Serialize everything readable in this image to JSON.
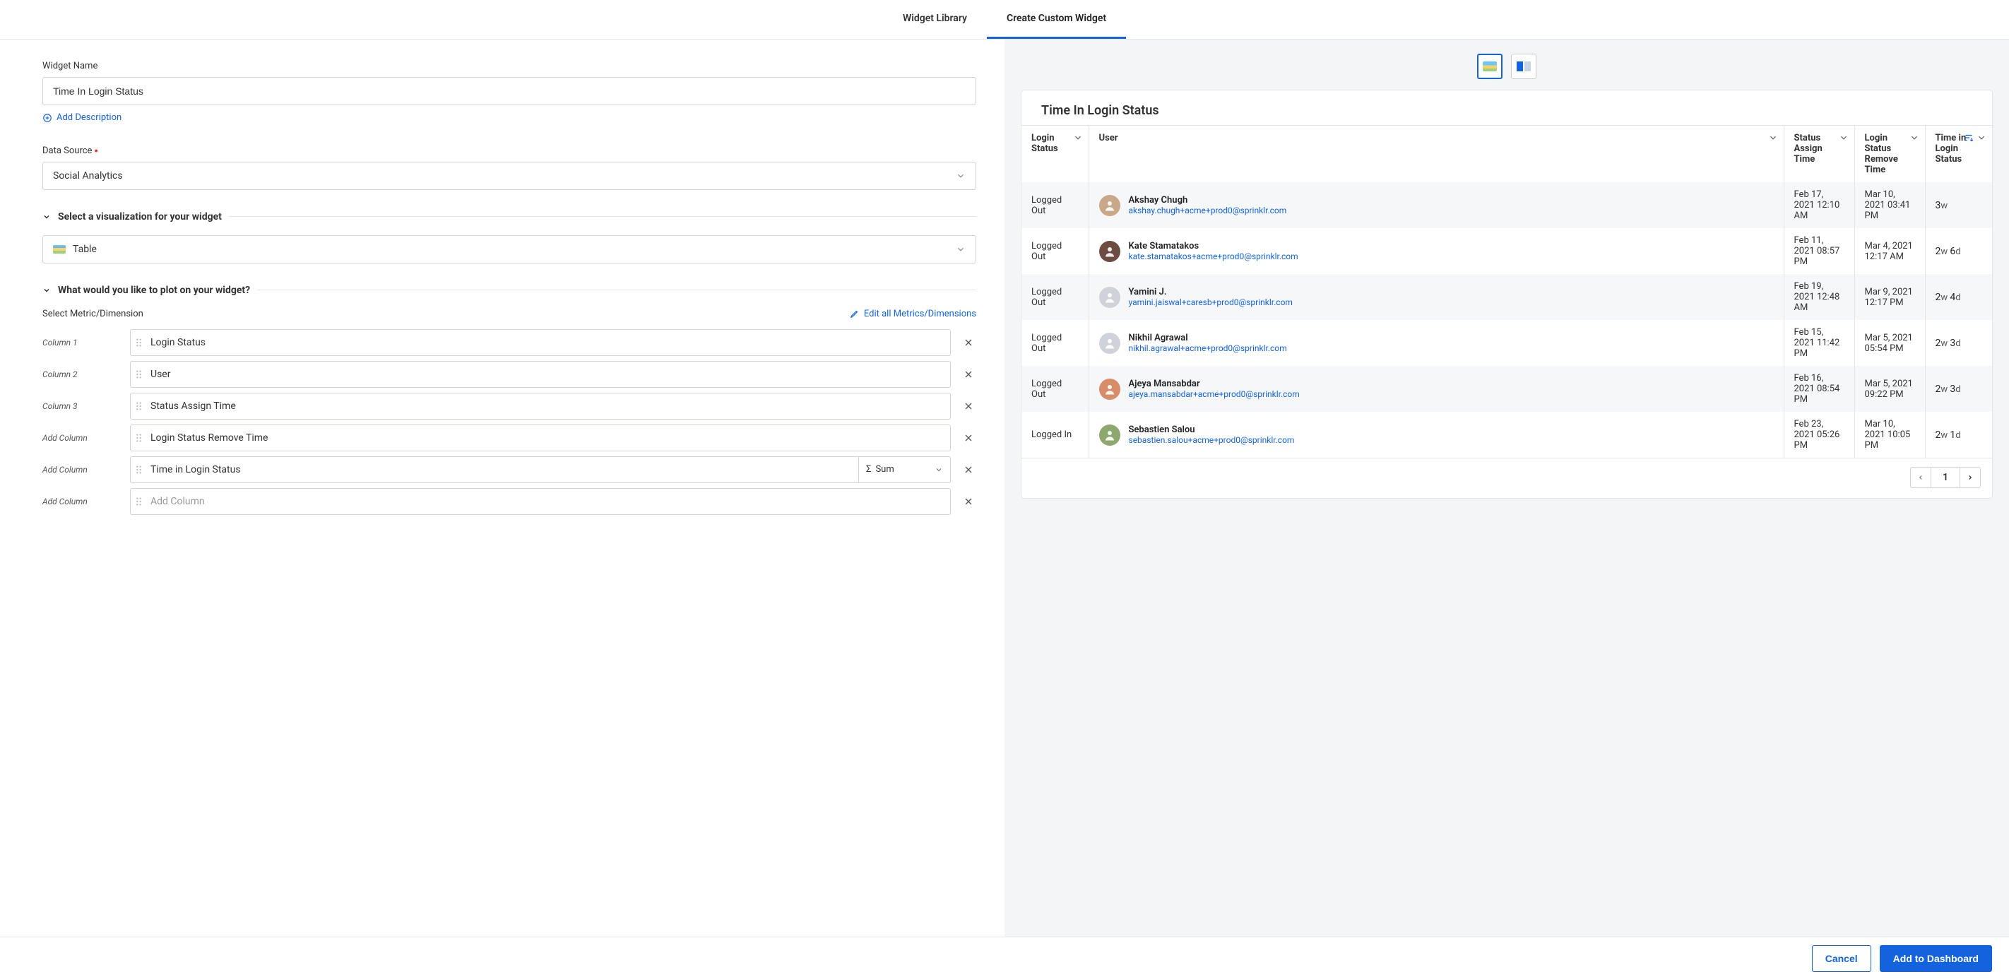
{
  "tabs": {
    "library": "Widget Library",
    "create": "Create Custom Widget"
  },
  "form": {
    "widget_name_label": "Widget Name",
    "widget_name_value": "Time In Login Status",
    "add_description": "Add Description",
    "data_source_label": "Data Source",
    "data_source_value": "Social Analytics",
    "viz_section": "Select a visualization for your widget",
    "viz_value": "Table",
    "plot_section": "What would you like to plot on your widget?",
    "metric_label": "Select Metric/Dimension",
    "edit_all": "Edit all Metrics/Dimensions",
    "columns": [
      {
        "label": "Column 1",
        "value": "Login Status",
        "agg": null
      },
      {
        "label": "Column 2",
        "value": "User",
        "agg": null
      },
      {
        "label": "Column 3",
        "value": "Status Assign Time",
        "agg": null
      },
      {
        "label": "Add Column",
        "value": "Login Status Remove Time",
        "agg": null
      },
      {
        "label": "Add Column",
        "value": "Time in Login Status",
        "agg": "Sum"
      },
      {
        "label": "Add Column",
        "value": "",
        "placeholder": "Add Column",
        "agg": null
      }
    ]
  },
  "preview": {
    "title": "Time In Login Status",
    "headers": {
      "login_status": "Login Status",
      "user": "User",
      "assign": "Status Assign Time",
      "remove": "Login Status Remove Time",
      "tils": "Time in Login Status"
    },
    "rows": [
      {
        "status": "Logged Out",
        "name": "Akshay Chugh",
        "email": "akshay.chugh+acme+prod0@sprinklr.com",
        "assign": "Feb 17, 2021 12:10 AM",
        "remove": "Mar 10, 2021 03:41 PM",
        "tils_a": "3",
        "tils_au": "w",
        "tils_b": "",
        "tils_bu": "",
        "avatar": "#c9a889"
      },
      {
        "status": "Logged Out",
        "name": "Kate Stamatakos",
        "email": "kate.stamatakos+acme+prod0@sprinklr.com",
        "assign": "Feb 11, 2021 08:57 PM",
        "remove": "Mar 4, 2021 12:17 AM",
        "tils_a": "2",
        "tils_au": "w",
        "tils_b": "6",
        "tils_bu": "d",
        "avatar": "#6d4c41"
      },
      {
        "status": "Logged Out",
        "name": "Yamini J.",
        "email": "yamini.jaiswal+caresb+prod0@sprinklr.com",
        "assign": "Feb 19, 2021 12:48 AM",
        "remove": "Mar 9, 2021 12:17 PM",
        "tils_a": "2",
        "tils_au": "w",
        "tils_b": "4",
        "tils_bu": "d",
        "avatar": "#cfd3d9"
      },
      {
        "status": "Logged Out",
        "name": "Nikhil Agrawal",
        "email": "nikhil.agrawal+acme+prod0@sprinklr.com",
        "assign": "Feb 15, 2021 11:42 PM",
        "remove": "Mar 5, 2021 05:54 PM",
        "tils_a": "2",
        "tils_au": "w",
        "tils_b": "3",
        "tils_bu": "d",
        "avatar": "#cfd3d9"
      },
      {
        "status": "Logged Out",
        "name": "Ajeya Mansabdar",
        "email": "ajeya.mansabdar+acme+prod0@sprinklr.com",
        "assign": "Feb 16, 2021 08:54 PM",
        "remove": "Mar 5, 2021 09:22 PM",
        "tils_a": "2",
        "tils_au": "w",
        "tils_b": "3",
        "tils_bu": "d",
        "avatar": "#d88c67"
      },
      {
        "status": "Logged In",
        "name": "Sebastien Salou",
        "email": "sebastien.salou+acme+prod0@sprinklr.com",
        "assign": "Feb 23, 2021 05:26 PM",
        "remove": "Mar 10, 2021 10:05 PM",
        "tils_a": "2",
        "tils_au": "w",
        "tils_b": "1",
        "tils_bu": "d",
        "avatar": "#8da86e"
      }
    ],
    "page": "1"
  },
  "footer": {
    "cancel": "Cancel",
    "add": "Add to Dashboard"
  }
}
